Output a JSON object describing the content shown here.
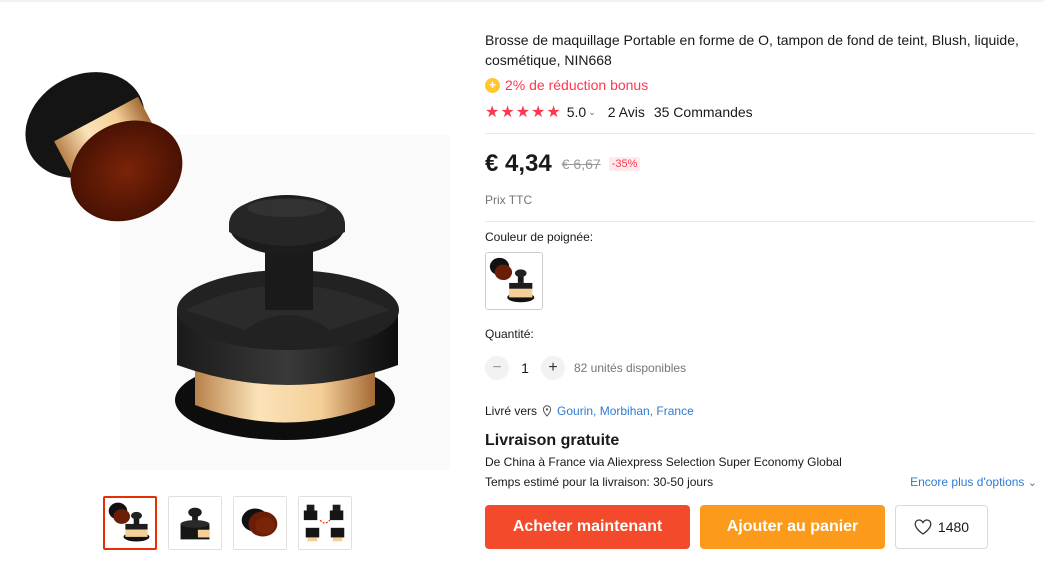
{
  "product": {
    "title": "Brosse de maquillage Portable en forme de O, tampon de fond de teint, Blush, liquide, cosmétique, NIN668",
    "bonus_text": "2% de réduction bonus",
    "bonus_icon": "plus-coin-icon",
    "rating": {
      "stars": 5,
      "score": "5.0",
      "reviews": "2 Avis",
      "orders": "35 Commandes"
    },
    "price": "€ 4,34",
    "old_price": "€ 6,67",
    "discount": "-35%",
    "tax_note": "Prix TTC"
  },
  "options": {
    "color_label": "Couleur de poignée:",
    "quantity_label": "Quantité:",
    "quantity_value": "1",
    "stock": "82 unités disponibles"
  },
  "shipping": {
    "ship_to_label": "Livré vers",
    "location": "Gourin, Morbihan, France",
    "title": "Livraison gratuite",
    "line1": "De China à France via Aliexpress Selection Super Economy Global",
    "line2": "Temps estimé pour la livraison: 30-50 jours",
    "more_options": "Encore plus d'options"
  },
  "actions": {
    "buy_now": "Acheter maintenant",
    "add_to_cart": "Ajouter au panier",
    "wishlist_count": "1480"
  },
  "gallery": {
    "thumbnail_count": 4,
    "active_index": 0
  },
  "colors": {
    "accent_red": "#f24a2b",
    "cart_orange": "#fb9a1b",
    "star_red": "#fd384f",
    "link_blue": "#2e7bd1",
    "bonus_yellow": "#ffc62e"
  }
}
